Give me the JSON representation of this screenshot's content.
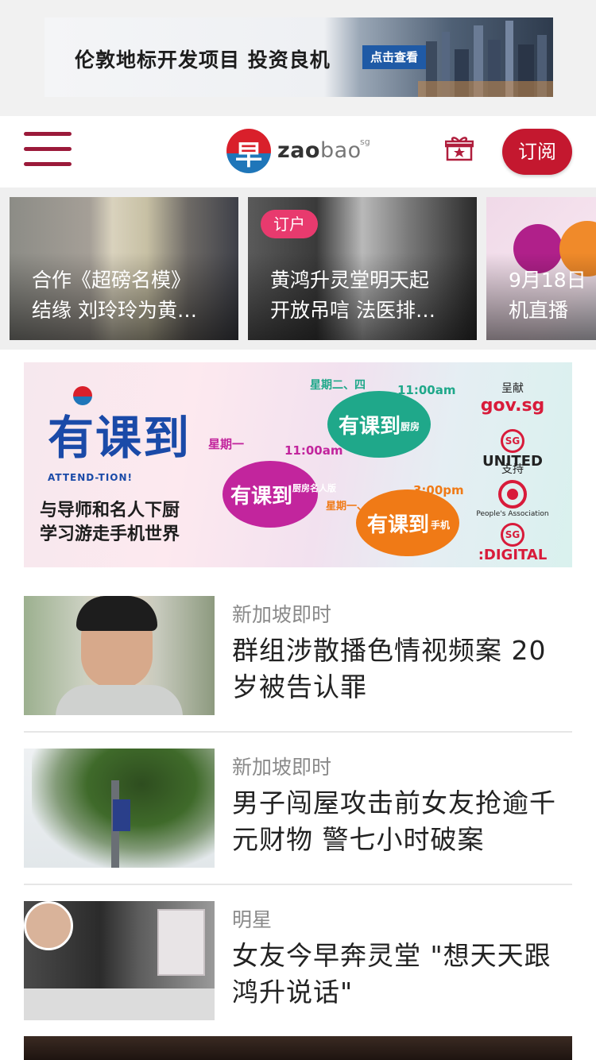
{
  "top_ad": {
    "headline": "伦敦地标开发项目 投资良机",
    "cta": "点击查看"
  },
  "header": {
    "logo_char": "早",
    "logo_word_bold": "zao",
    "logo_word_light": "bao",
    "logo_sg": "sg",
    "subscribe_label": "订阅"
  },
  "carousel": [
    {
      "line1": "合作《超磅名模》",
      "line2": "结缘 刘玲玲为黄…",
      "badge": ""
    },
    {
      "line1": "黄鸿升灵堂明天起",
      "line2": "开放吊唁 法医排…",
      "badge": "订户"
    },
    {
      "line1": "9月18日",
      "line2": "机直播",
      "badge": ""
    }
  ],
  "promo": {
    "brand": "有课到",
    "brand_sub": "ATTEND-TION!",
    "line1": "与导师和名人下厨",
    "line2": "学习游走手机世界",
    "blob_label": "有课到",
    "blob1_day": "星期一",
    "blob1_time": "11:00am",
    "blob1_sub": "厨房名人版",
    "blob2_day": "星期二、四",
    "blob2_time": "11:00am",
    "blob2_sub": "厨房",
    "blob3_day": "星期一、三、五",
    "blob3_time": "3:00pm",
    "blob3_sub": "手机",
    "presented_by": "呈献",
    "gov_sg": "gov.sg",
    "sg_united": "UNITED",
    "supported_by": "支持",
    "pa": "People's Association",
    "sg_digital": ":DIGITAL",
    "sg_short": "SG"
  },
  "news": [
    {
      "category": "新加坡即时",
      "title": "群组涉散播色情视频案 20岁被告认罪"
    },
    {
      "category": "新加坡即时",
      "title": "男子闯屋攻击前女友抢逾千元财物 警七小时破案"
    },
    {
      "category": "明星",
      "title": "女友今早奔灵堂 \"想天天跟鸿升说话\""
    }
  ]
}
